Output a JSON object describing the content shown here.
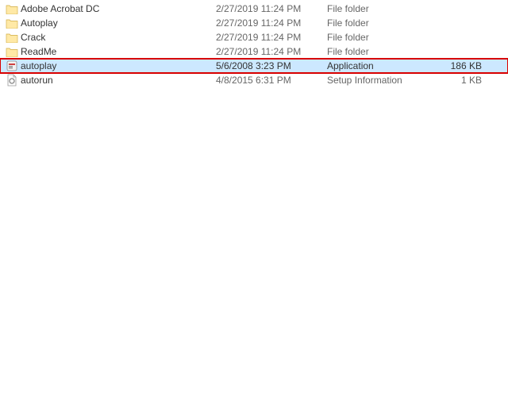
{
  "files": [
    {
      "name": "Adobe Acrobat DC",
      "date": "2/27/2019 11:24 PM",
      "type": "File folder",
      "size": "",
      "icon": "folder",
      "selected": false,
      "highlighted": false
    },
    {
      "name": "Autoplay",
      "date": "2/27/2019 11:24 PM",
      "type": "File folder",
      "size": "",
      "icon": "folder",
      "selected": false,
      "highlighted": false
    },
    {
      "name": "Crack",
      "date": "2/27/2019 11:24 PM",
      "type": "File folder",
      "size": "",
      "icon": "folder",
      "selected": false,
      "highlighted": false
    },
    {
      "name": "ReadMe",
      "date": "2/27/2019 11:24 PM",
      "type": "File folder",
      "size": "",
      "icon": "folder",
      "selected": false,
      "highlighted": false
    },
    {
      "name": "autoplay",
      "date": "5/6/2008 3:23 PM",
      "type": "Application",
      "size": "186 KB",
      "icon": "app",
      "selected": true,
      "highlighted": true
    },
    {
      "name": "autorun",
      "date": "4/8/2015 6:31 PM",
      "type": "Setup Information",
      "size": "1 KB",
      "icon": "inf",
      "selected": false,
      "highlighted": false
    }
  ]
}
